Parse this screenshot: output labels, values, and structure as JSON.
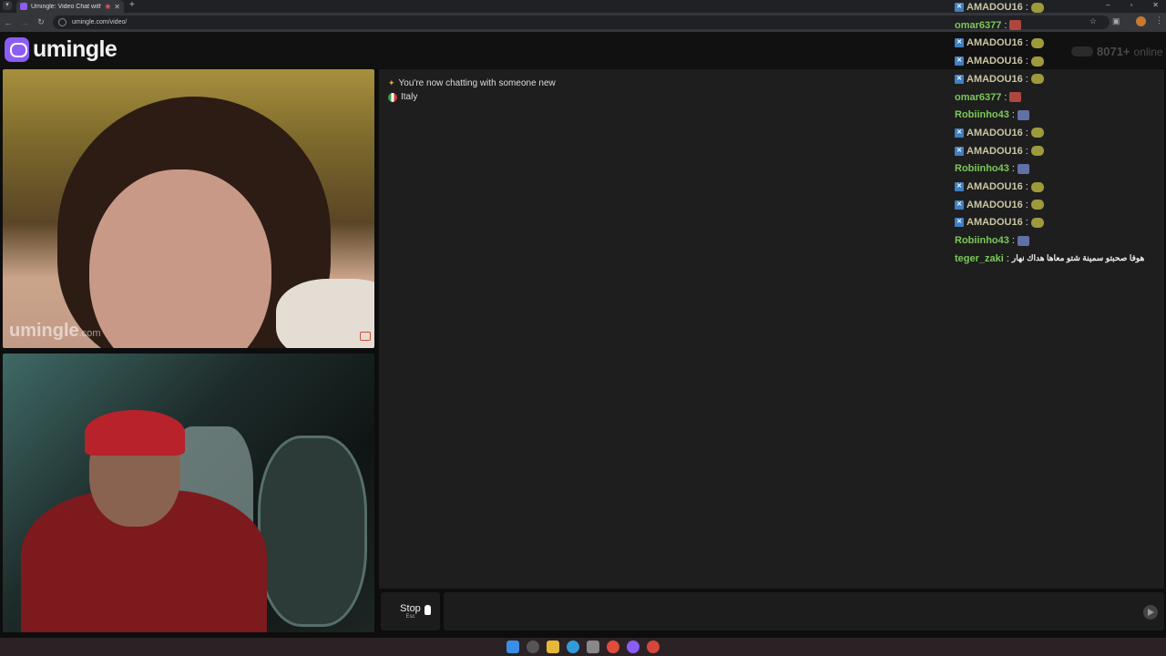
{
  "browser": {
    "tab_title": "Umingle: Video Chat with S",
    "url": "umingle.com/video/",
    "new_tab": "+",
    "tab_close": "✕"
  },
  "site": {
    "logo_text": "umingle",
    "online_count": "8071+",
    "online_label": "online",
    "accent_color": "#8b5cf6"
  },
  "video": {
    "watermark": "umingle",
    "watermark_suffix": ".com"
  },
  "chat": {
    "system_message": "You're now chatting with someone new",
    "country": "Italy"
  },
  "feed": [
    {
      "user": "AMADOU16",
      "badge": true,
      "style": "gold",
      "emoji": "fish"
    },
    {
      "user": "omar6377",
      "badge": false,
      "style": "green",
      "emoji": "red"
    },
    {
      "user": "AMADOU16",
      "badge": true,
      "style": "gold",
      "emoji": "fish"
    },
    {
      "user": "AMADOU16",
      "badge": true,
      "style": "gold",
      "emoji": "fish"
    },
    {
      "user": "AMADOU16",
      "badge": true,
      "style": "gold",
      "emoji": "fish"
    },
    {
      "user": "omar6377",
      "badge": false,
      "style": "green",
      "emoji": "red"
    },
    {
      "user": "Robiinho43",
      "badge": false,
      "style": "green",
      "emoji": "blue"
    },
    {
      "user": "AMADOU16",
      "badge": true,
      "style": "gold",
      "emoji": "fish"
    },
    {
      "user": "AMADOU16",
      "badge": true,
      "style": "gold",
      "emoji": "fish"
    },
    {
      "user": "Robiinho43",
      "badge": false,
      "style": "green",
      "emoji": "blue"
    },
    {
      "user": "AMADOU16",
      "badge": true,
      "style": "gold",
      "emoji": "fish"
    },
    {
      "user": "AMADOU16",
      "badge": true,
      "style": "gold",
      "emoji": "fish"
    },
    {
      "user": "AMADOU16",
      "badge": true,
      "style": "gold",
      "emoji": "fish"
    },
    {
      "user": "Robiinho43",
      "badge": false,
      "style": "green",
      "emoji": "blue"
    },
    {
      "user": "teger_zaki",
      "badge": false,
      "style": "green",
      "emoji": null,
      "text": "هوفا صحبتو سمينة شتو معاها هداك نهار"
    }
  ],
  "controls": {
    "stop_label": "Stop",
    "stop_hint": "Esc",
    "colon": ":"
  }
}
